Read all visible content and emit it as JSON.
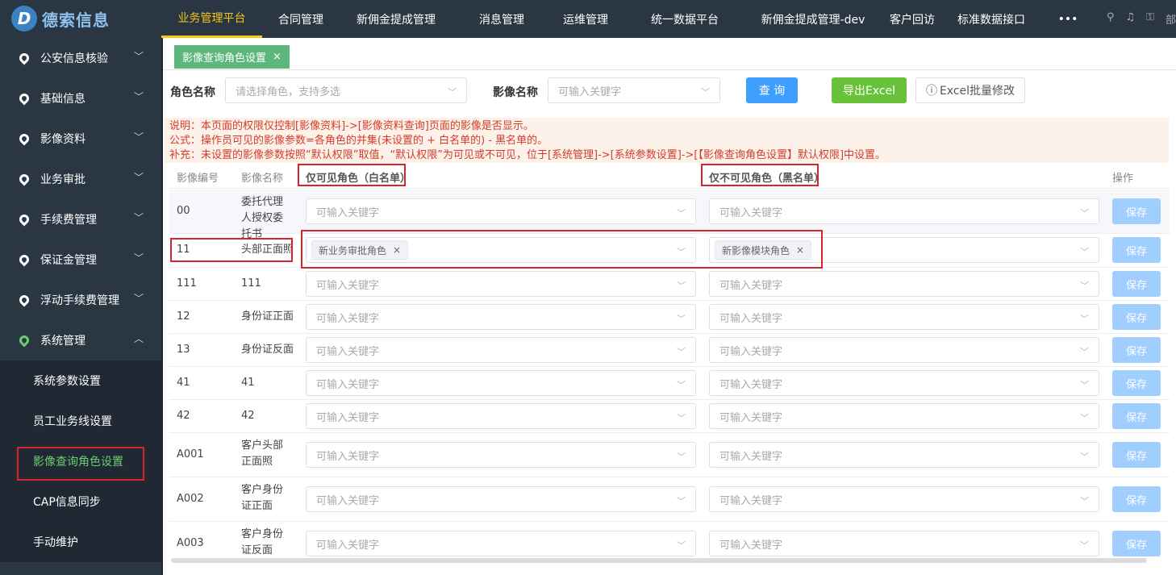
{
  "app": {
    "logo_mark": "D",
    "name": "德索信息"
  },
  "nav": {
    "items": [
      "业务管理平台",
      "合同管理",
      "新佣金提成管理",
      "消息管理",
      "运维管理",
      "统一数据平台",
      "新佣金提成管理-dev",
      "客户回访",
      "标准数据接口",
      "•••"
    ],
    "tools": [
      "⚲",
      "♫",
      "⚿",
      "部"
    ]
  },
  "sidebar": {
    "items": [
      "公安信息核验",
      "基础信息",
      "影像资料",
      "业务审批",
      "手续费管理",
      "保证金管理",
      "浮动手续费管理",
      "系统管理"
    ],
    "sub_items": [
      "系统参数设置",
      "员工业务线设置",
      "影像查询角色设置",
      "CAP信息同步",
      "手动维护"
    ]
  },
  "tab": {
    "label": "影像查询角色设置",
    "close": "×"
  },
  "filters": {
    "role_label": "角色名称",
    "role_placeholder": "请选择角色，支持多选",
    "image_label": "影像名称",
    "image_placeholder": "可输入关键字",
    "query": "查 询",
    "export": "导出Excel",
    "batch": "Excel批量修改",
    "batch_icon": "ⓘ"
  },
  "notice": {
    "line1": "说明：本页面的权限仅控制[影像资料]->[影像资料查询]页面的影像是否显示。",
    "line2": "公式：操作员可见的影像参数=各角色的并集(未设置的 + 白名单的) - 黑名单的。",
    "line3": "补充：未设置的影像参数按照“默认权限”取值，“默认权限”为可见或不可见，位于[系统管理]->[系统参数设置]->[【影像查询角色设置】默认权限]中设置。"
  },
  "table": {
    "headers": {
      "code": "影像编号",
      "name": "影像名称",
      "white": "仅可见角色（白名单）",
      "black": "仅不可见角色（黑名单）",
      "op": "操作"
    },
    "placeholder": "可输入关键字",
    "save": "保存",
    "rows": [
      {
        "code": "00",
        "name": "委托代理人授权委托书",
        "white": "",
        "black": ""
      },
      {
        "code": "11",
        "name": "头部正面照",
        "white": "新业务审批角色",
        "black": "新影像模块角色"
      },
      {
        "code": "111",
        "name": "111",
        "white": "",
        "black": ""
      },
      {
        "code": "12",
        "name": "身份证正面",
        "white": "",
        "black": ""
      },
      {
        "code": "13",
        "name": "身份证反面",
        "white": "",
        "black": ""
      },
      {
        "code": "41",
        "name": "41",
        "white": "",
        "black": ""
      },
      {
        "code": "42",
        "name": "42",
        "white": "",
        "black": ""
      },
      {
        "code": "A001",
        "name": "客户头部正面照",
        "white": "",
        "black": ""
      },
      {
        "code": "A002",
        "name": "客户身份证正面",
        "white": "",
        "black": ""
      },
      {
        "code": "A003",
        "name": "客户身份证反面",
        "white": "",
        "black": ""
      }
    ]
  },
  "colors": {
    "topbar": "#2b3643",
    "accent_nav": "#f5c518",
    "accent_green": "#6ecb73",
    "query_btn": "#409eff",
    "export_btn": "#67c23a",
    "save_btn": "#a0cfff",
    "annotation": "#d9232d"
  }
}
